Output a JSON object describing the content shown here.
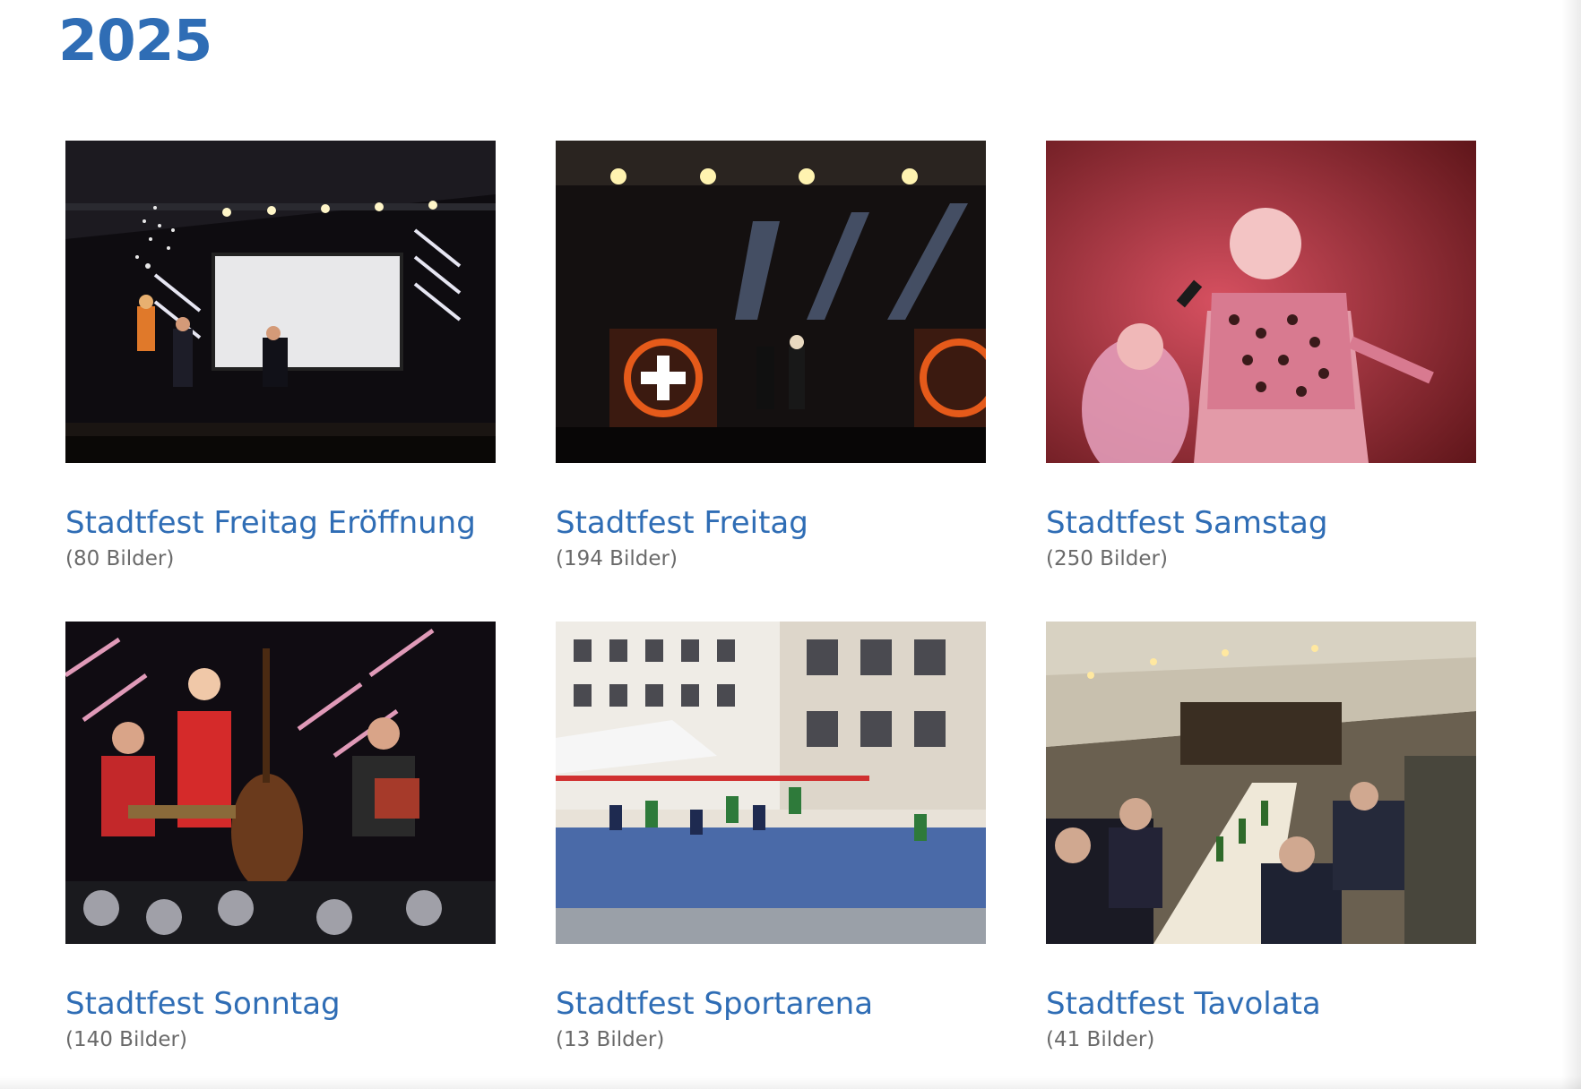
{
  "section": {
    "year": "2025"
  },
  "galleries": [
    {
      "title": "Stadtfest Freitag Eröffnung",
      "count": "(80 Bilder)",
      "image": "stage-show-with-fireworks-and-screen"
    },
    {
      "title": "Stadtfest Freitag",
      "count": "(194 Bilder)",
      "image": "rock-concert-stage-with-spotlights"
    },
    {
      "title": "Stadtfest Samstag",
      "count": "(250 Bilder)",
      "image": "singer-in-leopard-shirt-red-light"
    },
    {
      "title": "Stadtfest Sonntag",
      "count": "(140 Bilder)",
      "image": "folk-trio-with-double-bass-and-accordion"
    },
    {
      "title": "Stadtfest Sportarena",
      "count": "(13 Bilder)",
      "image": "street-volleyball-court"
    },
    {
      "title": "Stadtfest Tavolata",
      "count": "(41 Bilder)",
      "image": "long-dinner-table-under-tent"
    }
  ]
}
